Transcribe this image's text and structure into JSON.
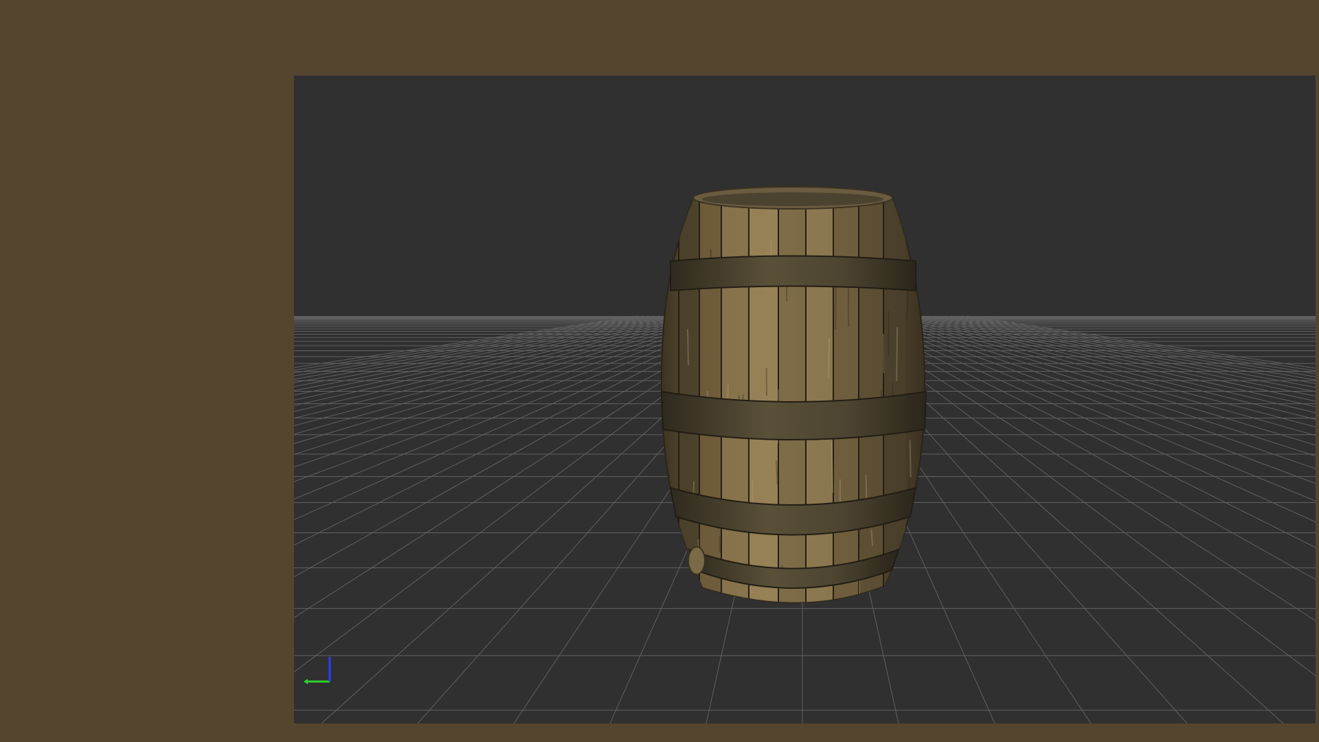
{
  "app": {
    "background_color": "#54452e"
  },
  "viewport": {
    "background_color": "#303030",
    "grid_color": "#8a8a8a",
    "object_icon": "barrel-model",
    "axis_gizmo": {
      "x_axis_color": "#2bd12b",
      "y_axis_color": "#2e3cff",
      "icon": "axis-gizmo-icon"
    }
  }
}
